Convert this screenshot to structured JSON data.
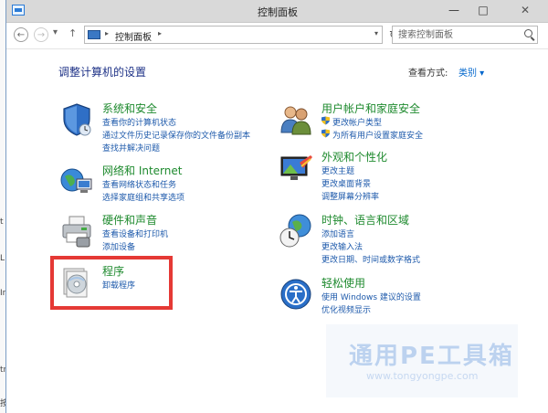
{
  "background": {
    "chars": [
      "t",
      "L",
      "Ir",
      "tr",
      "按"
    ]
  },
  "window": {
    "title": "控制面板",
    "controls": {
      "minimize": "—",
      "maximize": "□",
      "close": "✕"
    }
  },
  "navbar": {
    "back": "←",
    "forward": "→",
    "up": "↑",
    "breadcrumb_current": "控制面板",
    "refresh": "↻",
    "search_placeholder": "搜索控制面板"
  },
  "main": {
    "heading": "调整计算机的设置",
    "view_by_label": "查看方式:",
    "view_by_value": "类别 ▾",
    "categories_left": [
      {
        "title": "系统和安全",
        "links": [
          "查看你的计算机状态",
          "通过文件历史记录保存你的文件备份副本",
          "查找并解决问题"
        ],
        "icon": "shield-icon"
      },
      {
        "title": "网络和 Internet",
        "links": [
          "查看网络状态和任务",
          "选择家庭组和共享选项"
        ],
        "icon": "network-globe-icon"
      },
      {
        "title": "硬件和声音",
        "links": [
          "查看设备和打印机",
          "添加设备"
        ],
        "icon": "printer-icon"
      },
      {
        "title": "程序",
        "links": [
          "卸载程序"
        ],
        "icon": "programs-disc-icon"
      }
    ],
    "categories_right": [
      {
        "title": "用户帐户和家庭安全",
        "links": [
          "更改帐户类型",
          "为所有用户设置家庭安全"
        ],
        "icon": "users-icon"
      },
      {
        "title": "外观和个性化",
        "links": [
          "更改主题",
          "更改桌面背景",
          "调整屏幕分辨率"
        ],
        "icon": "appearance-icon"
      },
      {
        "title": "时钟、语言和区域",
        "links": [
          "添加语言",
          "更改输入法",
          "更改日期、时间或数字格式"
        ],
        "icon": "clock-globe-icon"
      },
      {
        "title": "轻松使用",
        "links": [
          "使用 Windows 建议的设置",
          "优化视频显示"
        ],
        "icon": "ease-of-access-icon"
      }
    ]
  },
  "watermark": {
    "title": "通用PE工具箱",
    "url": "www.tongyongpe.com"
  },
  "colors": {
    "category_title": "#1e8a2e",
    "link": "#1e5aab",
    "heading": "#1e3287",
    "highlight_box": "#e53935"
  }
}
